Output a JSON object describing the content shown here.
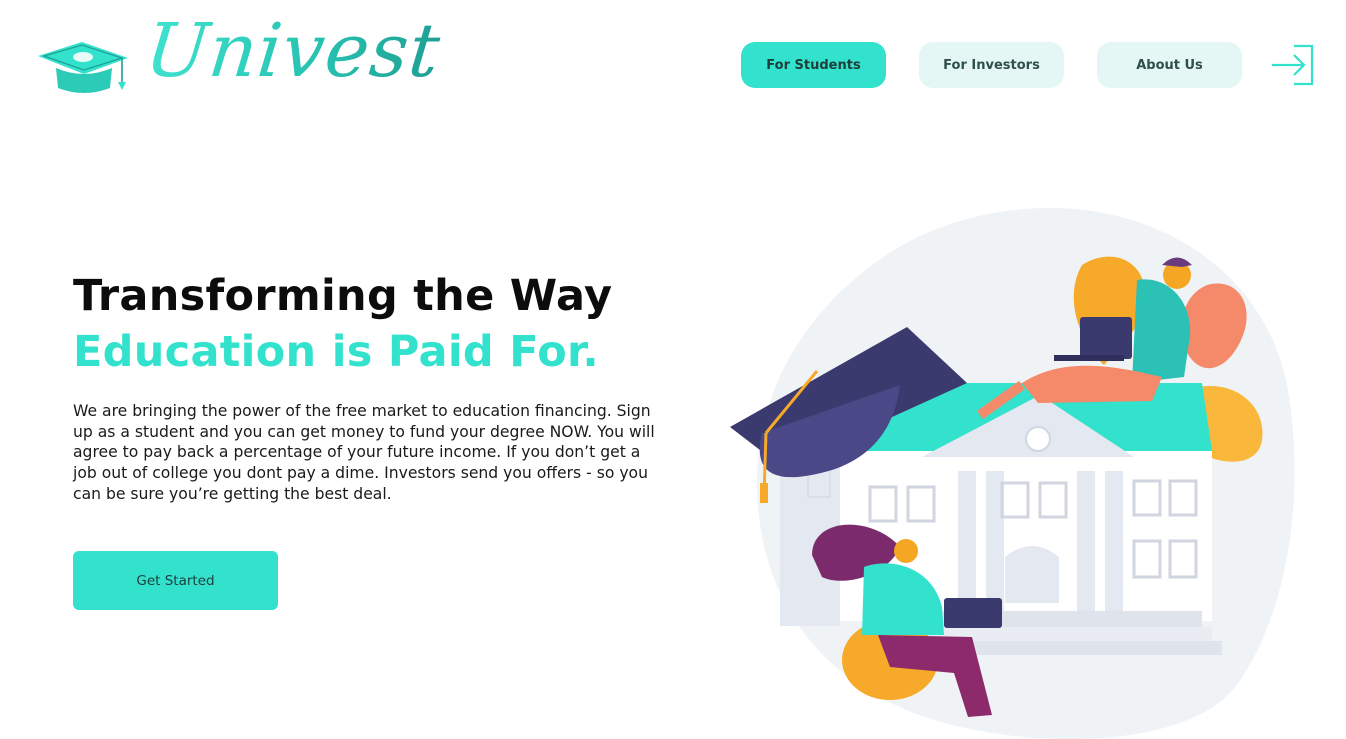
{
  "brand": {
    "name": "Univest",
    "icon": "graduation-cap-money-icon"
  },
  "nav": {
    "items": [
      {
        "label": "For Students",
        "active": true
      },
      {
        "label": "For Investors",
        "active": false
      },
      {
        "label": "About Us",
        "active": false
      }
    ],
    "login_icon": "login-arrow-icon"
  },
  "hero": {
    "title_line1": "Transforming the Way",
    "title_line2": "Education is Paid For.",
    "description": "We are bringing the power of the free market to education financing.  Sign up as a student and you can get money to fund your degree NOW. You will agree to pay back a percentage of your future income. If you don’t get a job out of college you dont pay a dime. Investors send you offers - so you can be sure you’re getting the best deal.",
    "cta_label": "Get Started"
  },
  "colors": {
    "accent": "#33e2cd",
    "accent_light": "#e4f7f5",
    "text_dark": "#0c0c0c",
    "navy": "#3b3a6e",
    "orange": "#f7a929",
    "coral": "#f58a6a",
    "purple": "#8c2a6b"
  },
  "illustration": {
    "icon": "university-students-illustration"
  }
}
